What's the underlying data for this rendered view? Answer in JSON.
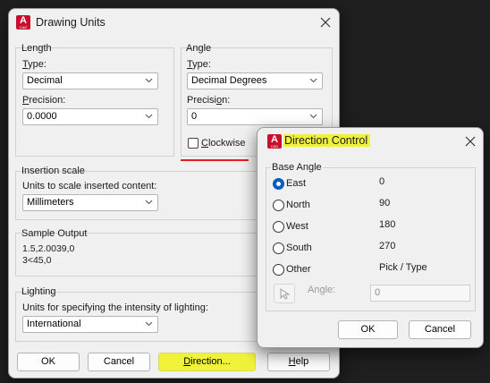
{
  "main": {
    "title": "Drawing Units",
    "length": {
      "group_label": "Length",
      "type_label": "Type:",
      "type_value": "Decimal",
      "precision_label": "Precision:",
      "precision_value": "0.0000"
    },
    "angle": {
      "group_label": "Angle",
      "type_label": "Type:",
      "type_value": "Decimal Degrees",
      "precision_label": "Precision:",
      "precision_value": "0",
      "clockwise_label": "Clockwise",
      "clockwise_checked": false
    },
    "insertion": {
      "group_label": "Insertion scale",
      "desc": "Units to scale inserted content:",
      "value": "Millimeters"
    },
    "sample": {
      "group_label": "Sample Output",
      "line1": "1.5,2.0039,0",
      "line2": "3<45,0"
    },
    "lighting": {
      "group_label": "Lighting",
      "desc": "Units for specifying the intensity of lighting:",
      "value": "International"
    },
    "buttons": {
      "ok": "OK",
      "cancel": "Cancel",
      "direction": "Direction...",
      "help": "Help"
    }
  },
  "direction": {
    "title": "Direction Control",
    "group_label": "Base Angle",
    "options": [
      {
        "label": "East",
        "value": "0",
        "checked": true
      },
      {
        "label": "North",
        "value": "90",
        "checked": false
      },
      {
        "label": "West",
        "value": "180",
        "checked": false
      },
      {
        "label": "South",
        "value": "270",
        "checked": false
      },
      {
        "label": "Other",
        "value": "Pick / Type",
        "checked": false
      }
    ],
    "angle_label": "Angle:",
    "angle_value": "0",
    "buttons": {
      "ok": "OK",
      "cancel": "Cancel"
    }
  },
  "app_icon": {
    "letter": "A",
    "subtext": "CAD"
  },
  "colors": {
    "highlight": "#f0f23a",
    "annotation_line": "#e02020",
    "radio_selected": "#0060c0",
    "app_icon": "#c8102e"
  }
}
